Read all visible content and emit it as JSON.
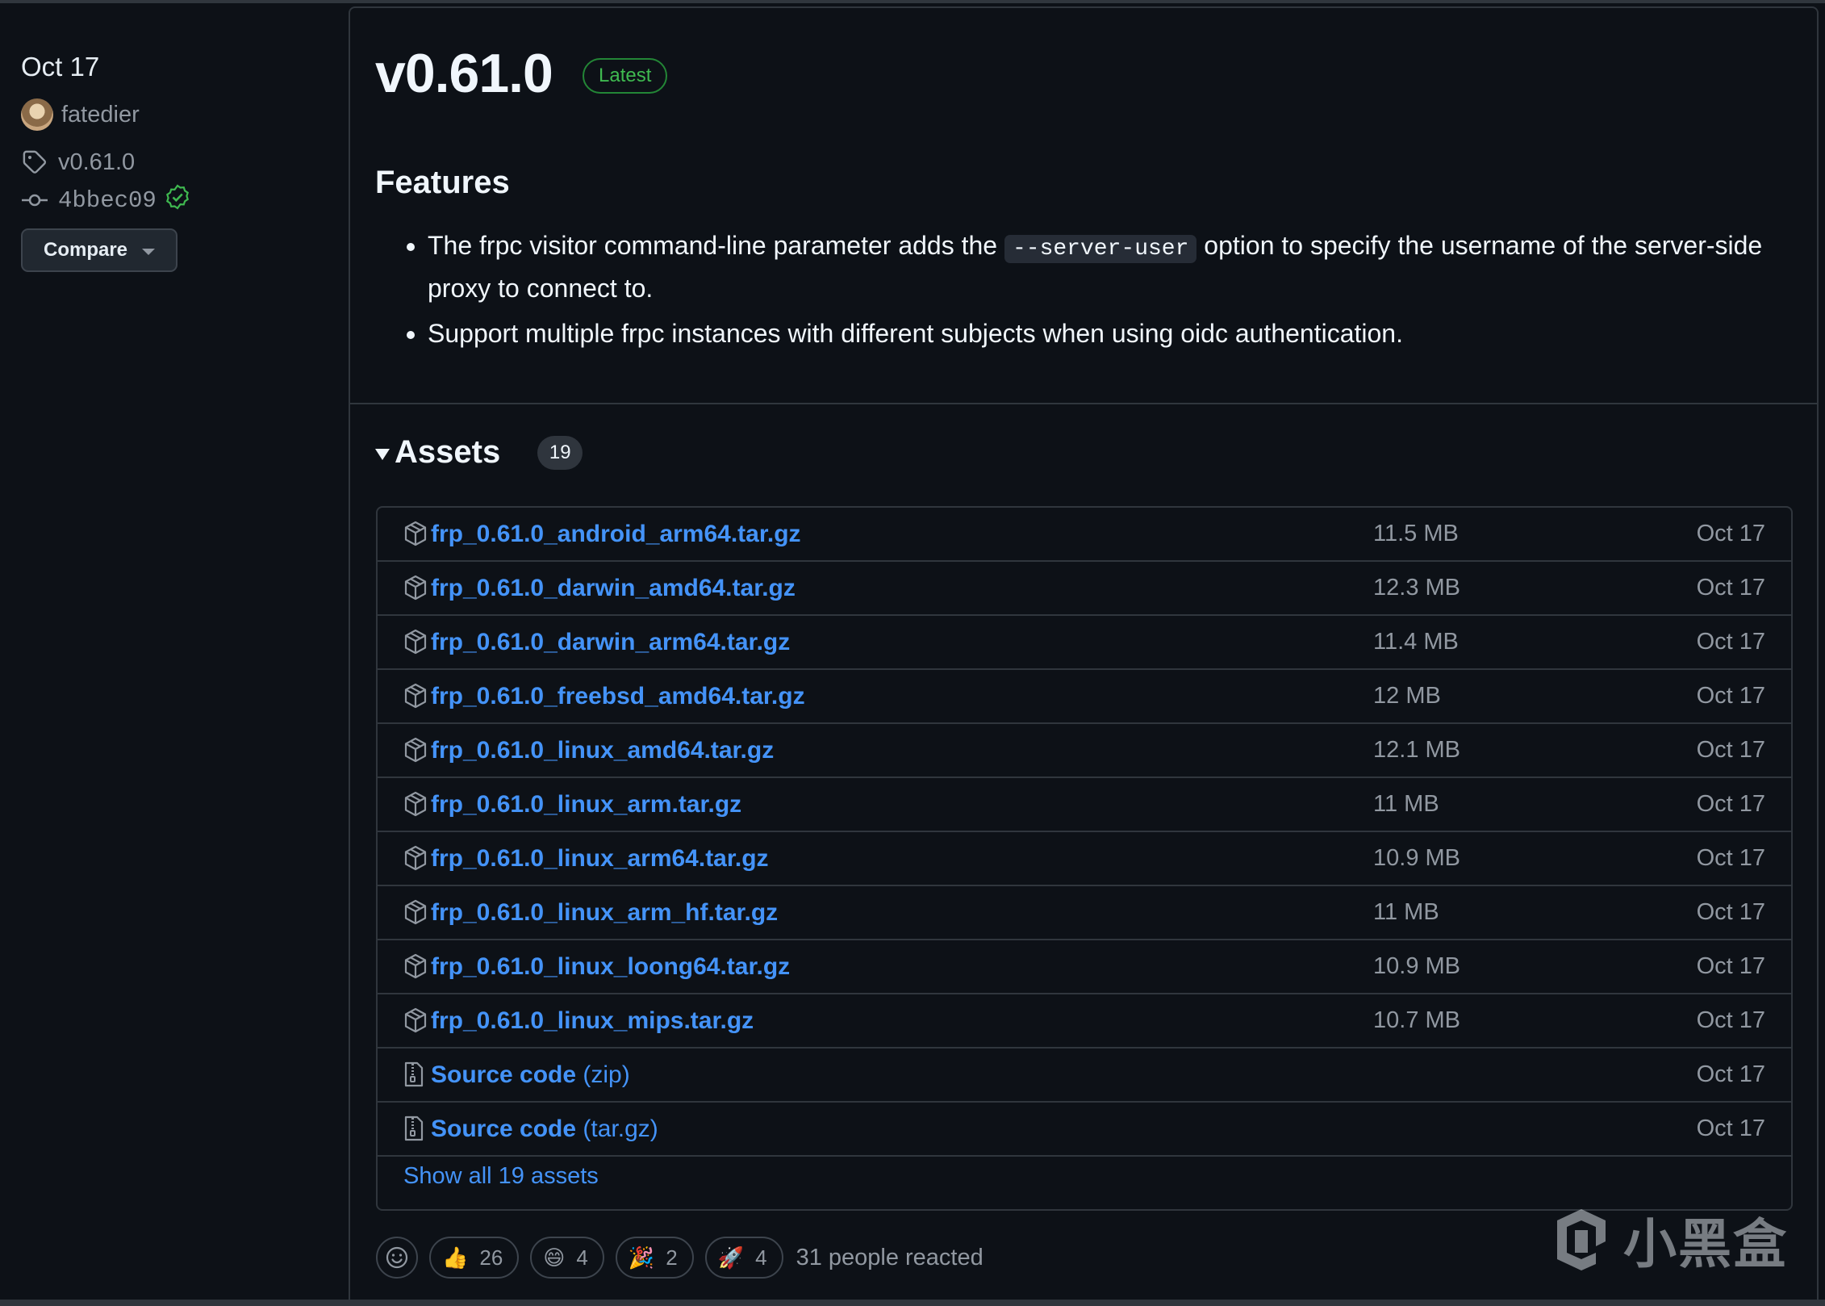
{
  "sidebar": {
    "date": "Oct 17",
    "author": "fatedier",
    "tag": "v0.61.0",
    "commit": "4bbec09",
    "compare_label": "Compare"
  },
  "release": {
    "title": "v0.61.0",
    "badge": "Latest",
    "features_heading": "Features",
    "feature1_before": "The frpc visitor command-line parameter adds the ",
    "feature1_code": "--server-user",
    "feature1_after": " option to specify the username of the server-side proxy to connect to.",
    "feature2": "Support multiple frpc instances with different subjects when using oidc authentication."
  },
  "assets": {
    "heading": "Assets",
    "count": "19",
    "items": [
      {
        "name": "frp_0.61.0_android_arm64.tar.gz",
        "size": "11.5 MB",
        "date": "Oct 17"
      },
      {
        "name": "frp_0.61.0_darwin_amd64.tar.gz",
        "size": "12.3 MB",
        "date": "Oct 17"
      },
      {
        "name": "frp_0.61.0_darwin_arm64.tar.gz",
        "size": "11.4 MB",
        "date": "Oct 17"
      },
      {
        "name": "frp_0.61.0_freebsd_amd64.tar.gz",
        "size": "12 MB",
        "date": "Oct 17"
      },
      {
        "name": "frp_0.61.0_linux_amd64.tar.gz",
        "size": "12.1 MB",
        "date": "Oct 17"
      },
      {
        "name": "frp_0.61.0_linux_arm.tar.gz",
        "size": "11 MB",
        "date": "Oct 17"
      },
      {
        "name": "frp_0.61.0_linux_arm64.tar.gz",
        "size": "10.9 MB",
        "date": "Oct 17"
      },
      {
        "name": "frp_0.61.0_linux_arm_hf.tar.gz",
        "size": "11 MB",
        "date": "Oct 17"
      },
      {
        "name": "frp_0.61.0_linux_loong64.tar.gz",
        "size": "10.9 MB",
        "date": "Oct 17"
      },
      {
        "name": "frp_0.61.0_linux_mips.tar.gz",
        "size": "10.7 MB",
        "date": "Oct 17"
      }
    ],
    "source": [
      {
        "name": "Source code",
        "suffix": "(zip)",
        "date": "Oct 17"
      },
      {
        "name": "Source code",
        "suffix": "(tar.gz)",
        "date": "Oct 17"
      }
    ],
    "show_all": "Show all 19 assets"
  },
  "reactions": {
    "items": [
      {
        "emoji": "👍",
        "count": "26"
      },
      {
        "emoji": "😄",
        "count": "4"
      },
      {
        "emoji": "🎉",
        "count": "2"
      },
      {
        "emoji": "🚀",
        "count": "4"
      }
    ],
    "summary": "31 people reacted"
  },
  "watermark": "小黑盒",
  "colors": {
    "background": "#0d1117",
    "link": "#4493f8",
    "latest": "#3fb950",
    "border": "#30363d"
  }
}
